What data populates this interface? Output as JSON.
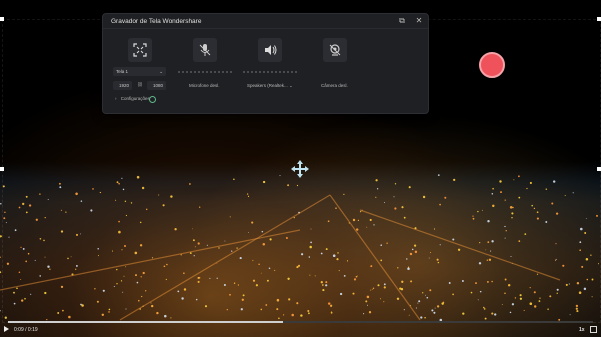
{
  "recorder": {
    "title": "Gravador de Tela Wondershare",
    "screen_select": "Tela 1",
    "width": "1920",
    "height": "1080",
    "mic_label": "Microfone desl.",
    "speaker_select": "Speakers (Realtek...",
    "camera_label": "Câmera desl.",
    "settings_label": "Configurações"
  },
  "player": {
    "time": "0:09 / 0:19",
    "progress": 0.47,
    "speed": "1x"
  },
  "colors": {
    "record": "#f0525c",
    "panel": "#1f2023"
  }
}
